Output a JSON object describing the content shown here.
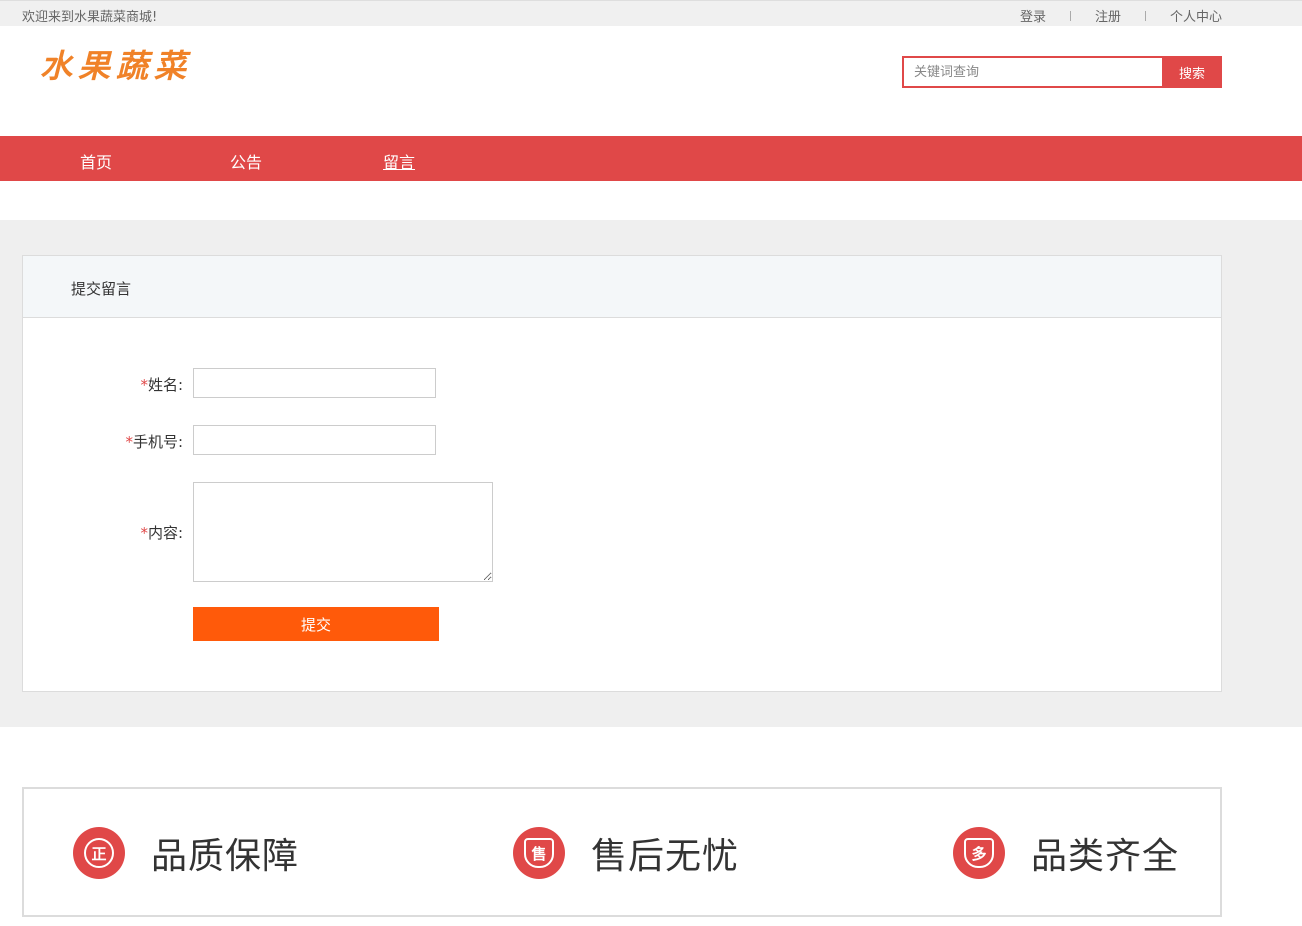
{
  "topbar": {
    "welcome": "欢迎来到水果蔬菜商城!",
    "login": "登录",
    "register": "注册",
    "user_center": "个人中心"
  },
  "header": {
    "logo_text": "水果蔬菜",
    "search_placeholder": "关键词查询",
    "search_button": "搜索"
  },
  "nav": {
    "items": [
      {
        "label": "首页"
      },
      {
        "label": "公告"
      },
      {
        "label": "留言"
      }
    ],
    "active": "留言"
  },
  "form": {
    "title": "提交留言",
    "required_mark": "*",
    "name_label": "姓名:",
    "phone_label": "手机号:",
    "content_label": "内容:",
    "submit_label": "提交"
  },
  "features": [
    {
      "icon": "certified-icon",
      "glyph": "正",
      "label": "品质保障"
    },
    {
      "icon": "shield-icon",
      "glyph": "售",
      "label": "售后无忧"
    },
    {
      "icon": "variety-icon",
      "glyph": "多",
      "label": "品类齐全"
    }
  ],
  "colors": {
    "brand_red": "#e04848",
    "submit_orange": "#ff5a0a",
    "logo_orange": "#f08228"
  }
}
